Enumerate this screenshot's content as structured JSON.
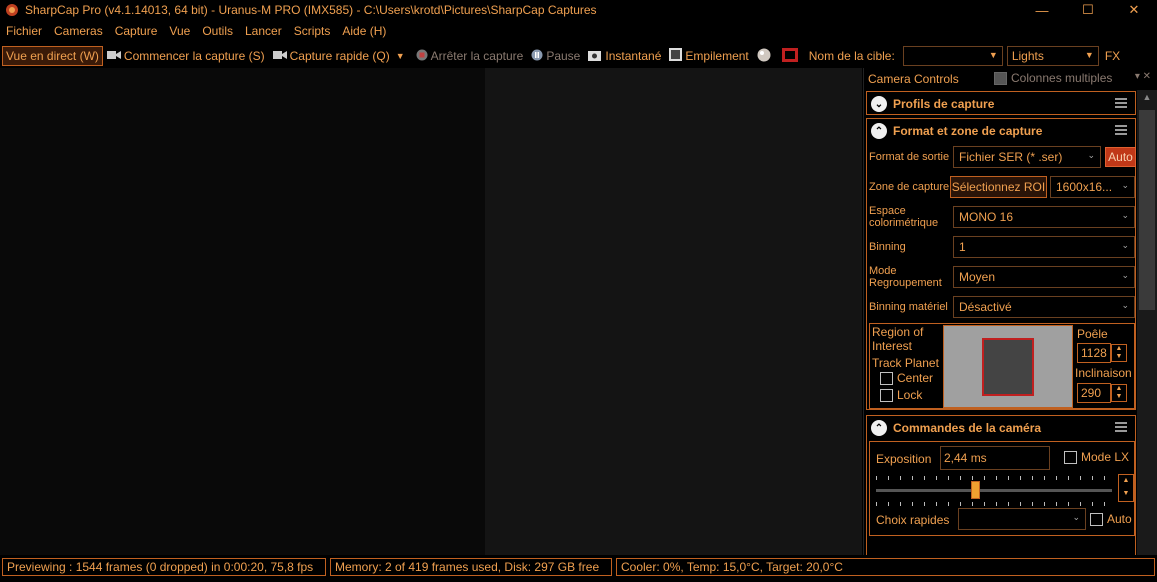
{
  "window": {
    "title": "SharpCap Pro (v4.1.14013, 64 bit) - Uranus-M PRO (IMX585) - C:\\Users\\krotd\\Pictures\\SharpCap Captures",
    "minimize": "—",
    "maximize": "☐",
    "close": "✕"
  },
  "menu": [
    "Fichier",
    "Cameras",
    "Capture",
    "Vue",
    "Outils",
    "Lancer",
    "Scripts",
    "Aide (H)"
  ],
  "toolbar": {
    "live": "Vue en direct (W)",
    "start_capture": "Commencer la capture (S)",
    "quick_capture": "Capture rapide (Q)",
    "stop_capture": "Arrêter la capture",
    "pause": "Pause",
    "snapshot": "Instantané",
    "stacking": "Empilement",
    "target_label": "Nom de la cible:",
    "target_value": "",
    "frame_type": "Lights",
    "fx": "FX"
  },
  "panel": {
    "title": "Camera Controls",
    "multi_columns": "Colonnes multiples",
    "profiles": {
      "title": "Profils de capture"
    },
    "format": {
      "title": "Format et zone de capture",
      "output_label": "Format de sortie",
      "output_value": "Fichier SER (* .ser)",
      "auto": "Auto",
      "zone_label": "Zone de capture",
      "roi_button": "Sélectionnez ROI",
      "resolution": "1600x16...",
      "colorspace_label_1": "Espace",
      "colorspace_label_2": "colorimétrique",
      "colorspace_value": "MONO 16",
      "binning_label": "Binning",
      "binning_value": "1",
      "mode_label_1": "Mode",
      "mode_label_2": "Regroupement",
      "mode_value": "Moyen",
      "hw_binning_label": "Binning matériel",
      "hw_binning_value": "Désactivé",
      "roi_label_1": "Region of",
      "roi_label_2": "Interest",
      "track_planet": "Track Planet",
      "center": "Center",
      "lock": "Lock",
      "pan_label": "Poêle",
      "pan_value": "1128",
      "tilt_label": "Inclinaison",
      "tilt_value": "290"
    },
    "camera": {
      "title": "Commandes de la caméra",
      "exposure_label": "Exposition",
      "exposure_value": "2,44 ms",
      "lx_mode": "Mode LX",
      "exposure_slider_fraction": 0.42,
      "quick_choice_label": "Choix rapides",
      "quick_choice_value": "",
      "auto": "Auto"
    }
  },
  "status": {
    "preview": "Previewing : 1544 frames (0 dropped) in 0:00:20, 75,8 fps",
    "memory": "Memory: 2 of 419 frames used, Disk: 297 GB free",
    "cooler": "Cooler: 0%, Temp: 15,0°C, Target: 20,0°C"
  }
}
